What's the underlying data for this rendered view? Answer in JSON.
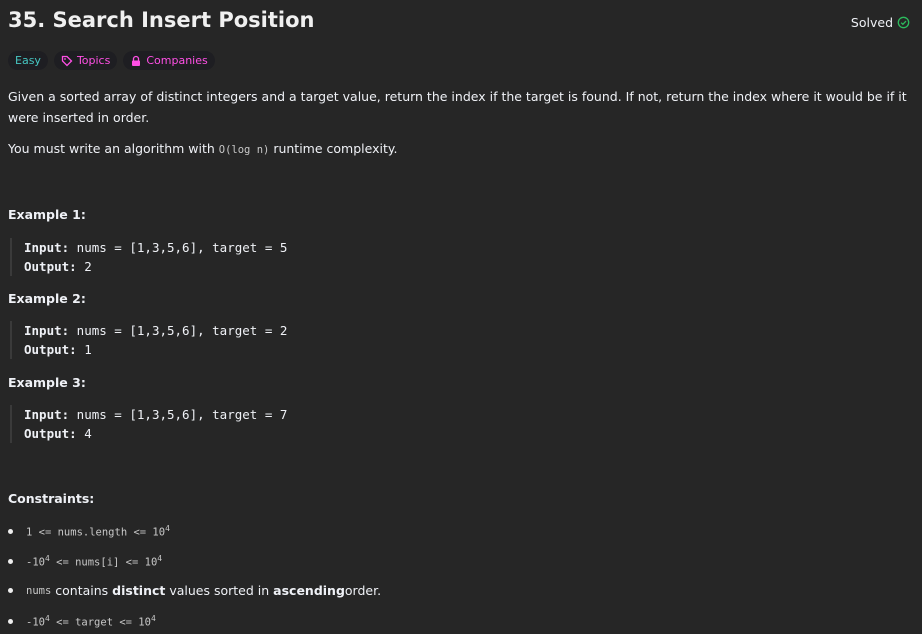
{
  "title": "35. Search Insert Position",
  "status": {
    "label": "Solved",
    "icon": "check-circle-icon",
    "color": "#2cbb5d"
  },
  "tags": {
    "difficulty": "Easy",
    "topics": "Topics",
    "companies": "Companies"
  },
  "description": {
    "p1": "Given a sorted array of distinct integers and a target value, return the index if the target is found. If not, return the index where it would be if it were inserted in order.",
    "p2_pre": "You must write an algorithm with ",
    "p2_code": "O(log n)",
    "p2_post": " runtime complexity."
  },
  "examples": [
    {
      "heading": "Example 1:",
      "input_label": "Input:",
      "input": " nums = [1,3,5,6], target = 5",
      "output_label": "Output:",
      "output": " 2"
    },
    {
      "heading": "Example 2:",
      "input_label": "Input:",
      "input": " nums = [1,3,5,6], target = 2",
      "output_label": "Output:",
      "output": " 1"
    },
    {
      "heading": "Example 3:",
      "input_label": "Input:",
      "input": " nums = [1,3,5,6], target = 7",
      "output_label": "Output:",
      "output": " 4"
    }
  ],
  "constraints": {
    "heading": "Constraints:",
    "c1": {
      "a": "1 <= nums.length <= 10",
      "sup": "4"
    },
    "c2": {
      "a": "-10",
      "sup1": "4",
      "b": " <= nums[i] <= 10",
      "sup2": "4"
    },
    "c3": {
      "code": "nums",
      "t1": " contains ",
      "b1": "distinct",
      "t2": " values sorted in ",
      "b2": "ascending",
      "t3": " order."
    },
    "c4": {
      "a": "-10",
      "sup1": "4",
      "b": " <= target <= 10",
      "sup2": "4"
    }
  }
}
